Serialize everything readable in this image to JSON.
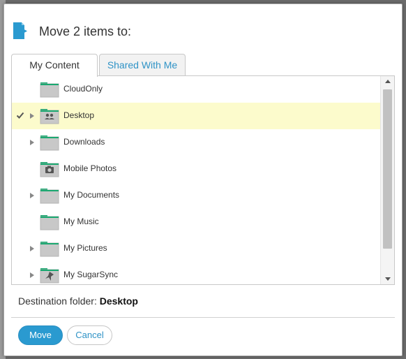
{
  "dialog": {
    "title": "Move 2 items to:",
    "accent_color": "#2a9ad0",
    "folder_color": "#c8c8c8",
    "folder_tab_color": "#1aa870"
  },
  "tabs": [
    {
      "label": "My Content",
      "active": true
    },
    {
      "label": "Shared With Me",
      "active": false
    }
  ],
  "folders": [
    {
      "name": "CloudOnly",
      "expandable": false,
      "selected": false,
      "icon": "folder-icon"
    },
    {
      "name": "Desktop",
      "expandable": true,
      "selected": true,
      "icon": "shared-folder-icon"
    },
    {
      "name": "Downloads",
      "expandable": true,
      "selected": false,
      "icon": "folder-icon"
    },
    {
      "name": "Mobile Photos",
      "expandable": false,
      "selected": false,
      "icon": "camera-folder-icon"
    },
    {
      "name": "My Documents",
      "expandable": true,
      "selected": false,
      "icon": "folder-icon"
    },
    {
      "name": "My Music",
      "expandable": false,
      "selected": false,
      "icon": "folder-icon"
    },
    {
      "name": "My Pictures",
      "expandable": true,
      "selected": false,
      "icon": "folder-icon"
    },
    {
      "name": "My SugarSync",
      "expandable": true,
      "selected": false,
      "icon": "sugarsync-folder-icon"
    }
  ],
  "destination": {
    "label": "Destination folder:",
    "value": "Desktop"
  },
  "buttons": {
    "move": "Move",
    "cancel": "Cancel"
  }
}
